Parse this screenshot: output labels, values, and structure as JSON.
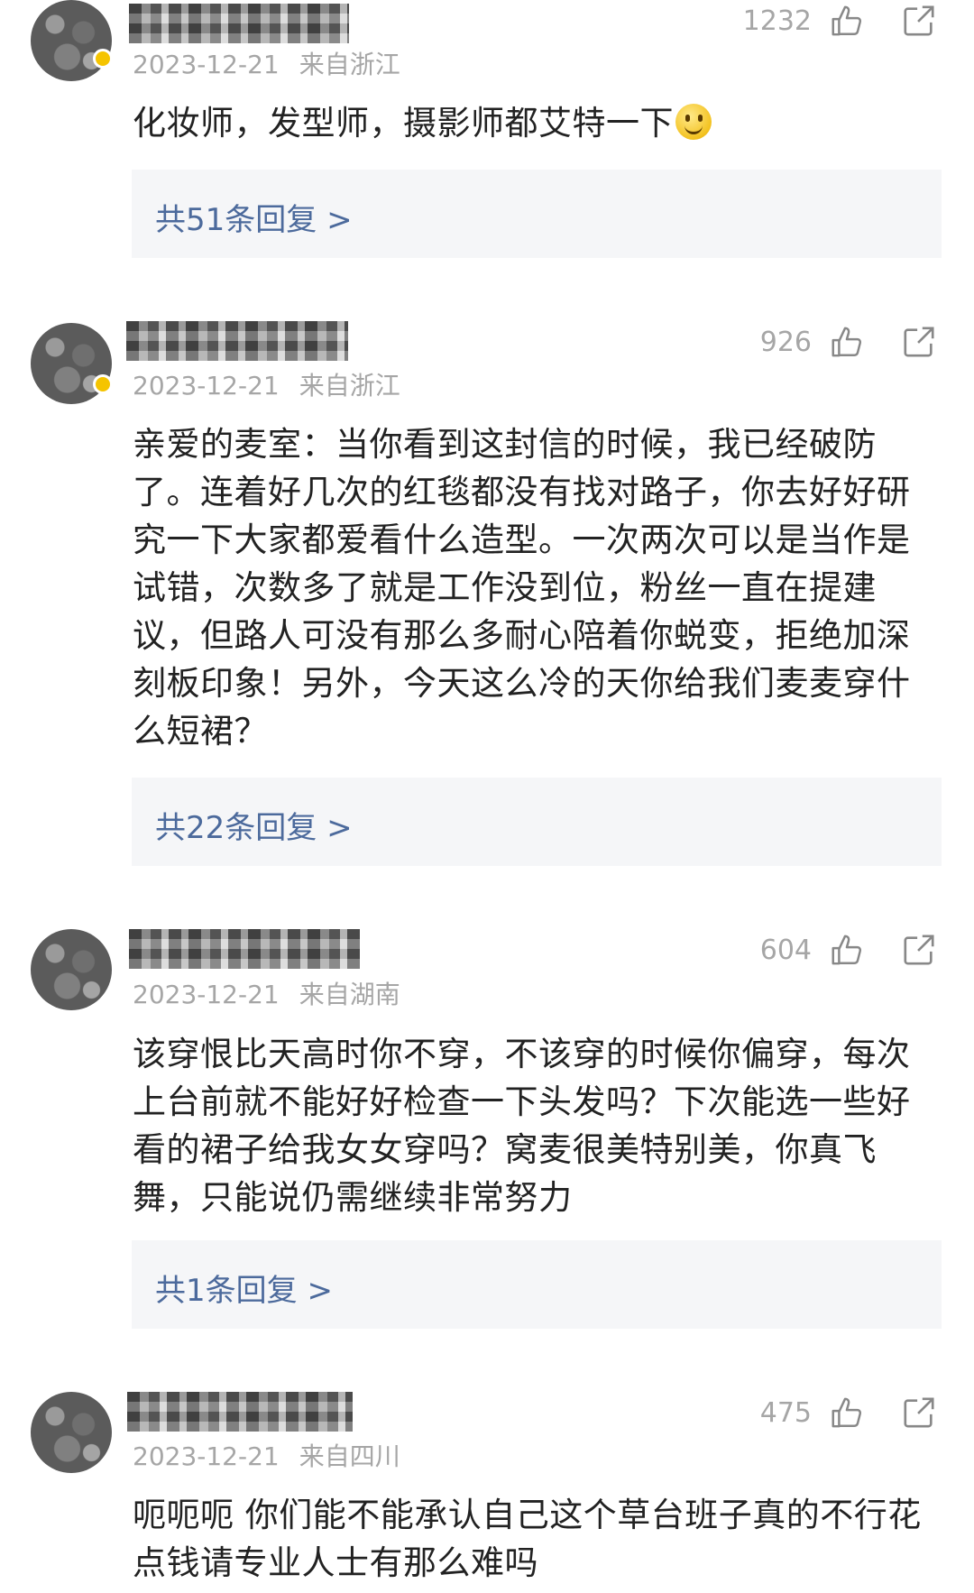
{
  "comments": [
    {
      "date": "2023-12-21",
      "location": "来自浙江",
      "likes": "1232",
      "text": "化妆师，发型师，摄影师都艾特一下",
      "has_emoji": true,
      "emoji_icon": "smiley-emoji",
      "reply_label": "共51条回复 >",
      "vip": true
    },
    {
      "date": "2023-12-21",
      "location": "来自浙江",
      "likes": "926",
      "text": "亲爱的麦室：当你看到这封信的时候，我已经破防了。连着好几次的红毯都没有找对路子，你去好好研究一下大家都爱看什么造型。一次两次可以是当作是试错，次数多了就是工作没到位，粉丝一直在提建议，但路人可没有那么多耐心陪着你蜕变，拒绝加深刻板印象！另外，今天这么冷的天你给我们麦麦穿什么短裙？",
      "reply_label": "共22条回复 >",
      "vip": true
    },
    {
      "date": "2023-12-21",
      "location": "来自湖南",
      "likes": "604",
      "text": "该穿恨比天高时你不穿，不该穿的时候你偏穿，每次上台前就不能好好检查一下头发吗？下次能选一些好看的裙子给我女女穿吗？窝麦很美特别美，你真飞舞，只能说仍需继续非常努力",
      "reply_label": "共1条回复 >",
      "vip": false
    },
    {
      "date": "2023-12-21",
      "location": "来自四川",
      "likes": "475",
      "text": "呃呃呃 你们能不能承认自己这个草台班子真的不行花点钱请专业人士有那么难吗",
      "vip": false
    }
  ],
  "icons": {
    "like": "thumbs-up-icon",
    "share": "share-icon"
  },
  "colors": {
    "meta": "#a6a6a6",
    "reply_link": "#4c6a9c",
    "reply_bg": "#f5f6f8",
    "vip_badge": "#f5c400"
  }
}
